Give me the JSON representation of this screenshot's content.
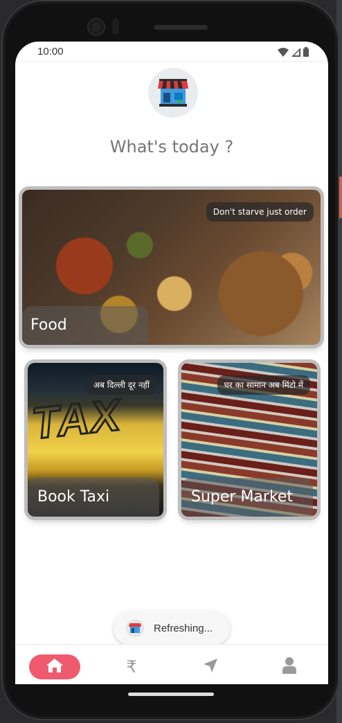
{
  "status_bar": {
    "time": "10:00",
    "icons": [
      "wifi-icon",
      "cellular-signal-icon",
      "battery-icon"
    ]
  },
  "header": {
    "logo_icon": "storefront-icon",
    "greeting": "What's today ?"
  },
  "cards": [
    {
      "name": "food",
      "title": "Food",
      "tagline": "Don't starve just order"
    },
    {
      "name": "taxi",
      "title": "Book Taxi",
      "tagline": "अब दिल्ली दूर नहीं"
    },
    {
      "name": "market",
      "title": "Super Market",
      "tagline": "घर का सामान अब मिंटो में"
    }
  ],
  "toast": {
    "text": "Refreshing..."
  },
  "bottom_nav": {
    "items": [
      "home-icon",
      "rupee-icon",
      "navigation-arrow-icon",
      "profile-icon"
    ],
    "active_color": "#ef5a6f",
    "inactive_color": "#9a9a9a"
  }
}
